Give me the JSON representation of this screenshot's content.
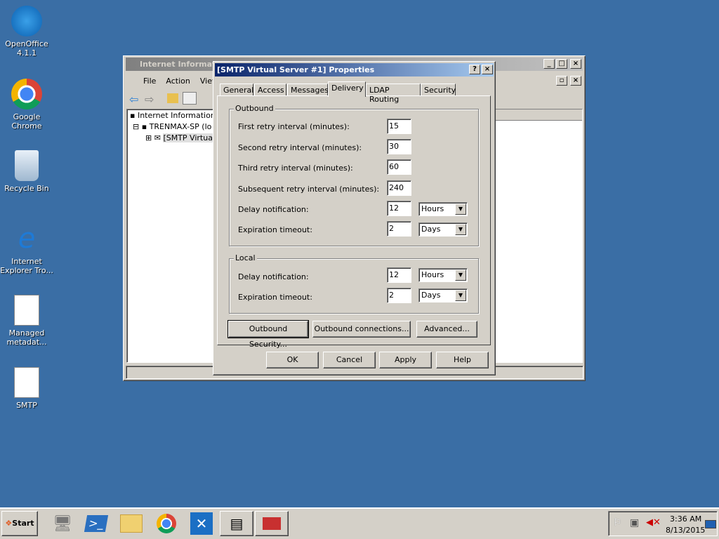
{
  "desktop": {
    "icons": [
      {
        "label": "OpenOffice 4.1.1",
        "icon": "openoffice-icon"
      },
      {
        "label": "Google Chrome",
        "icon": "chrome-icon"
      },
      {
        "label": "Recycle Bin",
        "icon": "recycle-bin-icon"
      },
      {
        "label": "Internet Explorer Tro...",
        "icon": "internet-explorer-icon"
      },
      {
        "label": "Managed metadat...",
        "icon": "document-icon"
      },
      {
        "label": "SMTP",
        "icon": "document-icon"
      }
    ]
  },
  "mmc": {
    "title": "Internet Informat",
    "menu": [
      "File",
      "Action",
      "View"
    ],
    "tree": [
      "Internet Information",
      "TRENMAX-SP (lo",
      "[SMTP Virtua"
    ]
  },
  "dialog": {
    "title": "[SMTP Virtual Server #1] Properties",
    "tabs": [
      "General",
      "Access",
      "Messages",
      "Delivery",
      "LDAP Routing",
      "Security"
    ],
    "active_tab": "Delivery",
    "outbound": {
      "label": "Outbound",
      "first_label": "First retry interval (minutes):",
      "first": "15",
      "second_label": "Second retry interval (minutes):",
      "second": "30",
      "third_label": "Third retry interval (minutes):",
      "third": "60",
      "subsequent_label": "Subsequent retry interval (minutes):",
      "subsequent": "240",
      "delay_label": "Delay notification:",
      "delay": "12",
      "delay_unit": "Hours",
      "expiration_label": "Expiration timeout:",
      "expiration": "2",
      "expiration_unit": "Days"
    },
    "local": {
      "label": "Local",
      "delay_label": "Delay notification:",
      "delay": "12",
      "delay_unit": "Hours",
      "expiration_label": "Expiration timeout:",
      "expiration": "2",
      "expiration_unit": "Days"
    },
    "buttons": {
      "outbound_security": "Outbound Security...",
      "outbound_connections": "Outbound connections...",
      "advanced": "Advanced...",
      "ok": "OK",
      "cancel": "Cancel",
      "apply": "Apply",
      "help": "Help"
    }
  },
  "taskbar": {
    "start": "Start",
    "time": "3:36 AM",
    "date": "8/13/2015"
  },
  "colors": {
    "desktop": "#3a6ea5",
    "titlebar": "#0a246a"
  }
}
